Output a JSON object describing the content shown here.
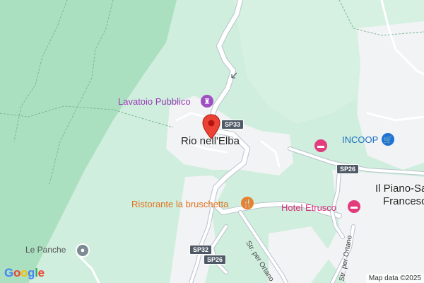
{
  "map": {
    "places": {
      "rio": "Rio nell'Elba",
      "piano_line1": "Il Piano-Sa",
      "piano_line2": "Francesc",
      "le_panche": "Le Panche"
    },
    "pois": {
      "lavatoio": "Lavatoio Pubblico",
      "incoop": "INCOOP",
      "hotel": "Hotel Etrusco",
      "ristorante": "Ristorante la bruschetta"
    },
    "roads": {
      "sp33": "SP33",
      "sp26_a": "SP26",
      "sp26_b": "SP26",
      "sp32": "SP32",
      "ortano_1": "Str. per Ortano",
      "ortano_2": "Str. per Ortano"
    },
    "attribution": "Map data ©2025",
    "logo": [
      "G",
      "o",
      "o",
      "g",
      "l",
      "e"
    ],
    "icons": {
      "pin": "location-pin-icon",
      "lavatoio": "landmark-icon",
      "incoop": "shopping-cart-icon",
      "hotel": "hotel-bed-icon",
      "ristorante": "restaurant-icon",
      "le_panche": "place-dot-icon",
      "arrow": "one-way-arrow-icon"
    },
    "colors": {
      "forest": "#cfeedd",
      "park_dark": "#aadfc0",
      "urban": "#f1f3f4",
      "road": "#ffffff",
      "road_outline": "#b9c3cc",
      "pin": "#ea4335"
    }
  }
}
